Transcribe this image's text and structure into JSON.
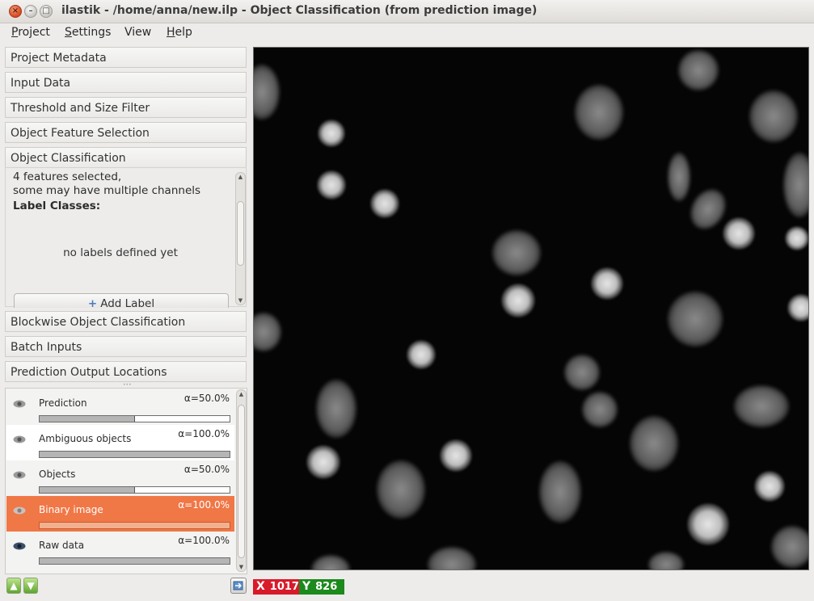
{
  "window": {
    "title": "ilastik - /home/anna/new.ilp - Object Classification (from prediction image)",
    "buttons": {
      "close": "×",
      "minimize": "–",
      "maximize": "□"
    }
  },
  "menubar": {
    "items": [
      {
        "label": "Project",
        "mnemonic": "P",
        "rest": "roject"
      },
      {
        "label": "Settings",
        "mnemonic": "S",
        "rest": "ettings"
      },
      {
        "label": "View",
        "mnemonic": "",
        "rest": "View"
      },
      {
        "label": "Help",
        "mnemonic": "H",
        "rest": "elp"
      }
    ]
  },
  "applets": {
    "top": [
      "Project Metadata",
      "Input Data",
      "Threshold and Size Filter",
      "Object Feature Selection",
      "Object Classification"
    ],
    "bottom": [
      "Blockwise Object Classification",
      "Batch Inputs",
      "Prediction Output Locations"
    ]
  },
  "drawer": {
    "features_line1": "4 features selected,",
    "features_line2": "some may have multiple channels",
    "label_classes": "Label Classes:",
    "no_labels": "no labels defined yet",
    "add_label": "Add Label",
    "add_label_icon": "plus-icon"
  },
  "layers": [
    {
      "name": "Prediction",
      "alpha": "α=50.0%",
      "opacity": 0.5,
      "selected": false,
      "eye": "eye-icon"
    },
    {
      "name": "Ambiguous objects",
      "alpha": "α=100.0%",
      "opacity": 1.0,
      "selected": false,
      "eye": "eye-icon"
    },
    {
      "name": "Objects",
      "alpha": "α=50.0%",
      "opacity": 0.5,
      "selected": false,
      "eye": "eye-icon"
    },
    {
      "name": "Binary image",
      "alpha": "α=100.0%",
      "opacity": 1.0,
      "selected": true,
      "eye": "eye-icon"
    },
    {
      "name": "Raw data",
      "alpha": "α=100.0%",
      "opacity": 1.0,
      "selected": false,
      "eye": "eye-icon"
    }
  ],
  "layer_controls": {
    "move_up": "arrow-up-icon",
    "move_down": "arrow-down-icon",
    "tool": "layer-tool-icon"
  },
  "status": {
    "x_label": "X",
    "x_value": "1017",
    "y_label": "Y",
    "y_value": "826"
  },
  "colors": {
    "selected_layer": "#f07746",
    "x_badge": "#d81b2a",
    "y_badge": "#1c8a1c"
  }
}
